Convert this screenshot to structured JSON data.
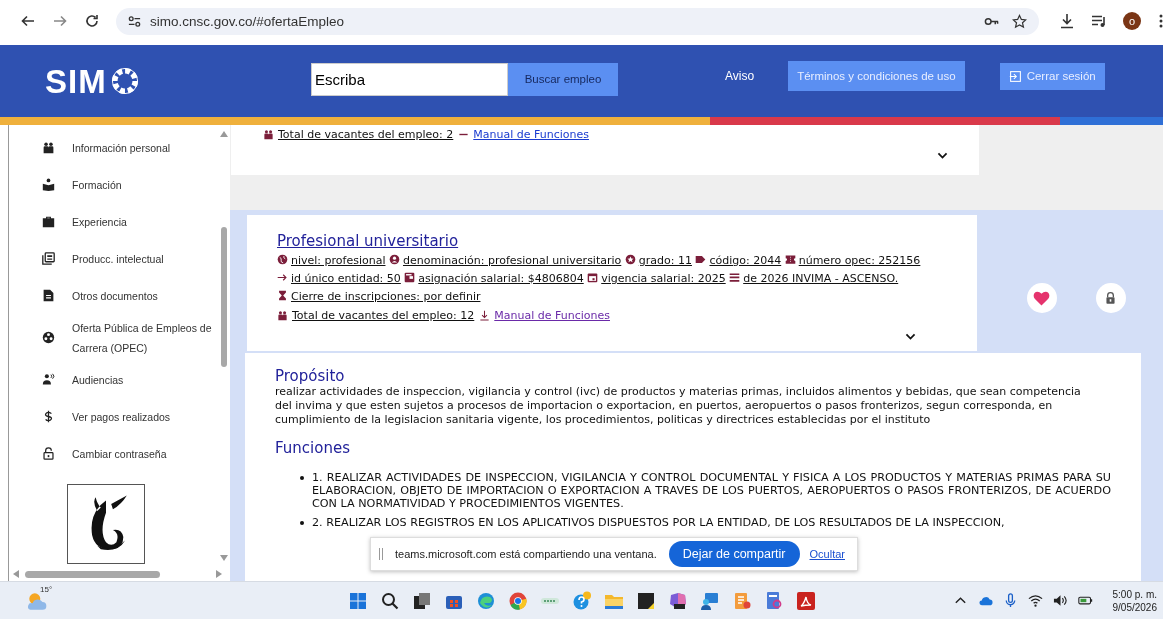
{
  "browser": {
    "url": "simo.cnsc.gov.co/#ofertaEmpleo",
    "profile_initial": "o"
  },
  "header": {
    "logo": "SIM",
    "search": {
      "value": "Escriba"
    },
    "search_button": "Buscar empleo",
    "actions": [
      {
        "label": "Aviso",
        "kind": "link"
      },
      {
        "label": "Términos y condiciones de uso",
        "kind": "button"
      },
      {
        "label": "Cerrar sesión",
        "kind": "logout"
      }
    ]
  },
  "sidebar": {
    "items": [
      {
        "label": "Información personal"
      },
      {
        "label": "Formación"
      },
      {
        "label": "Experiencia"
      },
      {
        "label": "Producc. intelectual"
      },
      {
        "label": "Otros documentos"
      },
      {
        "label": "Oferta Pública de Empleos de Carrera (OPEC)"
      },
      {
        "label": "Audiencias"
      },
      {
        "label": "Ver pagos realizados"
      },
      {
        "label": "Cambiar contraseña"
      }
    ]
  },
  "previous_job": {
    "vacancies": "Total de vacantes del empleo: 2",
    "manual_link": "Manual de Funciones"
  },
  "job": {
    "title": "Profesional universitario",
    "details": [
      {
        "text": "nivel: profesional"
      },
      {
        "text": "denominación: profesional universitario"
      },
      {
        "text": "grado: 11"
      },
      {
        "text": "código: 2044"
      },
      {
        "text": "número opec: 252156"
      },
      {
        "text": "id único entidad: 50"
      },
      {
        "text": "asignación salarial: $4806804"
      },
      {
        "text": "vigencia salarial: 2025"
      },
      {
        "text": "de 2026 INVIMA - ASCENSO."
      },
      {
        "text": "Cierre de inscripciones: por definir"
      }
    ],
    "vacancies": "Total de vacantes del empleo: 12",
    "manual_link": "Manual de Funciones",
    "favorite": true,
    "locked": true
  },
  "description": {
    "purpose_heading": "Propósito",
    "purpose": "realizar actividades de inspeccion, vigilancia y control (ivc) de productos y materias primas, incluidos alimentos y bebidas, que sean competencia del invima y que esten sujetos a procesos de importacion o exportacion, en puertos, aeropuertos o pasos fronterizos, segun corresponda, en cumplimiento de la legislacion sanitaria vigente, los procedimientos, politicas y directrices establecidas por el instituto",
    "functions_heading": "Funciones",
    "functions": [
      "1. REALIZAR ACTIVIDADES DE INSPECCION, VIGILANCIA Y CONTROL DOCUMENTAL Y FISICA A LOS PRODUCTOS Y MATERIAS PRIMAS PARA SU ELABORACION, OBJETO DE IMPORTACION O EXPORTACION A TRAVES DE LOS PUERTOS, AEROPUERTOS O PASOS FRONTERIZOS, DE ACUERDO CON LA NORMATIVIDAD Y PROCEDIMIENTOS VIGENTES.",
      "2. REALIZAR LOS REGISTROS EN LOS APLICATIVOS DISPUESTOS POR LA ENTIDAD, DE LOS RESULTADOS DE LA INSPECCION,"
    ]
  },
  "share_bar": {
    "message": "teams.microsoft.com está compartiendo una ventana.",
    "stop_button": "Dejar de compartir",
    "hide_link": "Ocultar"
  },
  "taskbar": {
    "weather": "15°",
    "time": "5:00 p. m.",
    "date": "9/05/2026"
  }
}
